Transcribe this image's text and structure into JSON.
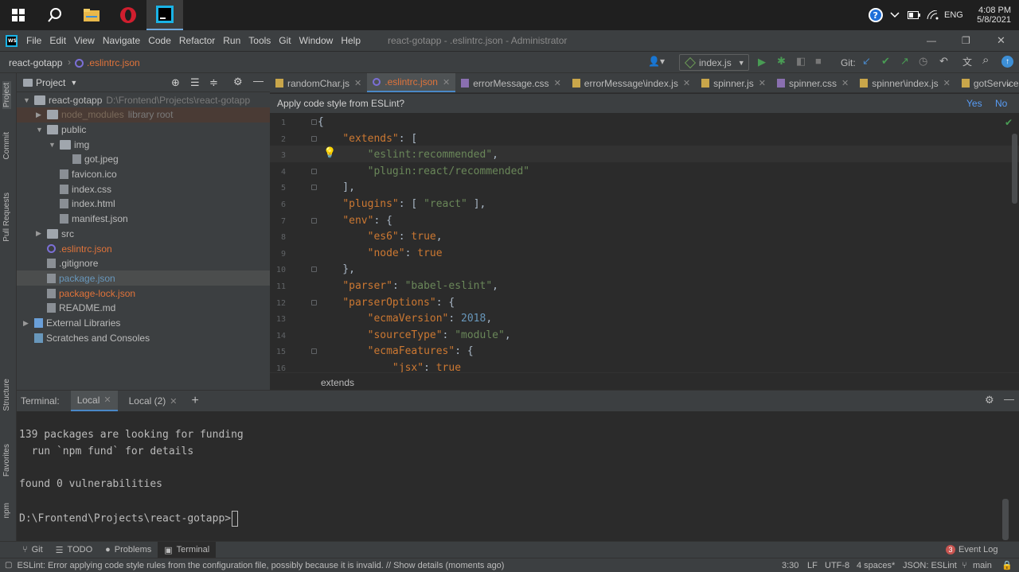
{
  "taskbar": {
    "time": "4:08 PM",
    "date": "5/8/2021",
    "lang": "ENG"
  },
  "window": {
    "title": "react-gotapp - .eslintrc.json - Administrator",
    "menu": [
      "File",
      "Edit",
      "View",
      "Navigate",
      "Code",
      "Refactor",
      "Run",
      "Tools",
      "Git",
      "Window",
      "Help"
    ]
  },
  "nav": {
    "project": "react-gotapp",
    "file": ".eslintrc.json",
    "run_config": "index.js",
    "git_label": "Git:"
  },
  "left_tools": [
    "Project",
    "Commit",
    "Pull Requests",
    "Structure",
    "Favorites",
    "npm"
  ],
  "project_panel": {
    "title": "Project",
    "tree": [
      {
        "label": "react-gotapp",
        "extra": "D:\\Frontend\\Projects\\react-gotapp",
        "type": "folder",
        "depth": 0,
        "open": true
      },
      {
        "label": "node_modules",
        "extra": "library root",
        "type": "folder",
        "depth": 1,
        "open": false,
        "excluded": true
      },
      {
        "label": "public",
        "type": "folder",
        "depth": 1,
        "open": true
      },
      {
        "label": "img",
        "type": "folder",
        "depth": 2,
        "open": true
      },
      {
        "label": "got.jpeg",
        "type": "file",
        "depth": 3
      },
      {
        "label": "favicon.ico",
        "type": "file",
        "depth": 2
      },
      {
        "label": "index.css",
        "type": "file",
        "depth": 2
      },
      {
        "label": "index.html",
        "type": "file",
        "depth": 2
      },
      {
        "label": "manifest.json",
        "type": "file",
        "depth": 2
      },
      {
        "label": "src",
        "type": "folder",
        "depth": 1,
        "open": false
      },
      {
        "label": ".eslintrc.json",
        "type": "file",
        "depth": 1,
        "color": "#e0733a"
      },
      {
        "label": ".gitignore",
        "type": "file",
        "depth": 1
      },
      {
        "label": "package.json",
        "type": "file",
        "depth": 1,
        "color": "#6897bb",
        "selected": true
      },
      {
        "label": "package-lock.json",
        "type": "file",
        "depth": 1,
        "color": "#e0733a"
      },
      {
        "label": "README.md",
        "type": "file",
        "depth": 1
      },
      {
        "label": "External Libraries",
        "type": "lib",
        "depth": 0,
        "open": false
      },
      {
        "label": "Scratches and Consoles",
        "type": "scratch",
        "depth": 0
      }
    ]
  },
  "tabs": [
    {
      "label": "randomChar.js"
    },
    {
      "label": ".eslintrc.json",
      "active": true
    },
    {
      "label": "errorMessage.css"
    },
    {
      "label": "errorMessage\\index.js"
    },
    {
      "label": "spinner.js"
    },
    {
      "label": "spinner.css"
    },
    {
      "label": "spinner\\index.js"
    },
    {
      "label": "gotService"
    }
  ],
  "banner": {
    "text": "Apply code style from ESLint?",
    "yes": "Yes",
    "no": "No"
  },
  "code_lines": [
    [
      [
        "",
        "{"
      ]
    ],
    [
      [
        "",
        "    "
      ],
      [
        "k",
        "\"extends\""
      ],
      [
        "",
        ": ["
      ]
    ],
    [
      [
        "",
        "        "
      ],
      [
        "s",
        "\"eslint:recommended\""
      ],
      [
        "",
        ","
      ]
    ],
    [
      [
        "",
        "        "
      ],
      [
        "s",
        "\"plugin:react/recommended\""
      ]
    ],
    [
      [
        "",
        "    ],"
      ]
    ],
    [
      [
        "",
        "    "
      ],
      [
        "k",
        "\"plugins\""
      ],
      [
        "",
        ": [ "
      ],
      [
        "s",
        "\"react\""
      ],
      [
        "",
        " ],"
      ]
    ],
    [
      [
        "",
        "    "
      ],
      [
        "k",
        "\"env\""
      ],
      [
        "",
        ": {"
      ]
    ],
    [
      [
        "",
        "        "
      ],
      [
        "k",
        "\"es6\""
      ],
      [
        "",
        ": "
      ],
      [
        "k",
        "true"
      ],
      [
        "",
        ","
      ]
    ],
    [
      [
        "",
        "        "
      ],
      [
        "k",
        "\"node\""
      ],
      [
        "",
        ": "
      ],
      [
        "k",
        "true"
      ]
    ],
    [
      [
        "",
        "    },"
      ]
    ],
    [
      [
        "",
        "    "
      ],
      [
        "k",
        "\"parser\""
      ],
      [
        "",
        ": "
      ],
      [
        "s",
        "\"babel-eslint\""
      ],
      [
        "",
        ","
      ]
    ],
    [
      [
        "",
        "    "
      ],
      [
        "k",
        "\"parserOptions\""
      ],
      [
        "",
        ": {"
      ]
    ],
    [
      [
        "",
        "        "
      ],
      [
        "k",
        "\"ecmaVersion\""
      ],
      [
        "",
        ": "
      ],
      [
        "n",
        "2018"
      ],
      [
        "",
        ","
      ]
    ],
    [
      [
        "",
        "        "
      ],
      [
        "k",
        "\"sourceType\""
      ],
      [
        "",
        ": "
      ],
      [
        "s",
        "\"module\""
      ],
      [
        "",
        ","
      ]
    ],
    [
      [
        "",
        "        "
      ],
      [
        "k",
        "\"ecmaFeatures\""
      ],
      [
        "",
        ": {"
      ]
    ],
    [
      [
        "",
        "            "
      ],
      [
        "k",
        "\"jsx\""
      ],
      [
        "",
        ": "
      ],
      [
        "k",
        "true"
      ]
    ]
  ],
  "breadcrumb": "extends",
  "terminal": {
    "label": "Terminal:",
    "tabs": [
      "Local",
      "Local (2)"
    ],
    "lines": [
      "139 packages are looking for funding",
      "  run `npm fund` for details",
      "",
      "found 0 vulnerabilities",
      "",
      "D:\\Frontend\\Projects\\react-gotapp>"
    ]
  },
  "bottom_tools": [
    "Git",
    "TODO",
    "Problems",
    "Terminal"
  ],
  "event_log": {
    "count": "3",
    "label": "Event Log"
  },
  "status": {
    "message": "ESLint: Error applying code style rules from the configuration file, possibly because it is invalid. // Show details (moments ago)",
    "position": "3:30",
    "line_sep": "LF",
    "encoding": "UTF-8",
    "indent": "4 spaces*",
    "schema": "JSON: ESLint",
    "branch": "main"
  }
}
